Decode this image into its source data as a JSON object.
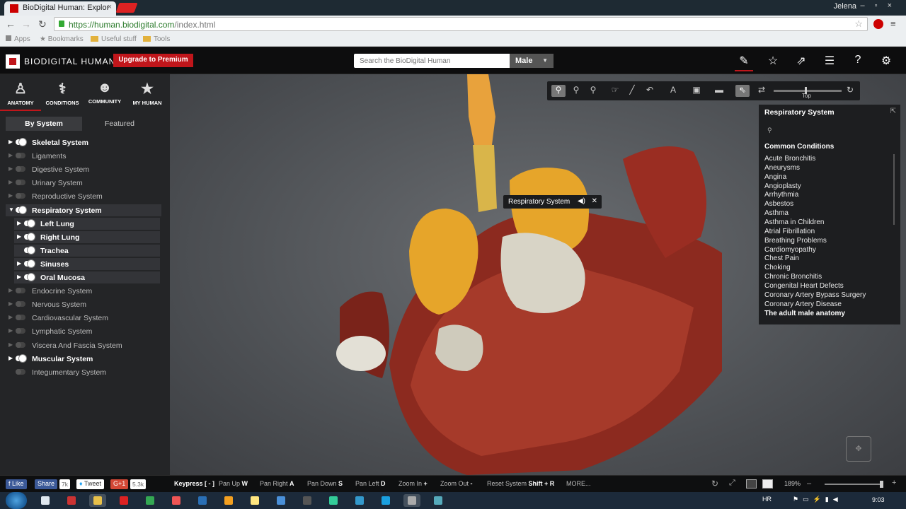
{
  "browser": {
    "tab_title": "BioDigital Human: Explor",
    "user_name": "Jelena",
    "url_secure": "https://human.biodigital.com",
    "url_path": "/index.html",
    "bookmarks": [
      "Apps",
      "Bookmarks",
      "Useful stuff",
      "Tools"
    ]
  },
  "header": {
    "brand": "BIODIGITAL HUMAN",
    "upgrade_label": "Upgrade to Premium",
    "search_placeholder": "Search the BioDigital Human",
    "gender": "Male",
    "icons": [
      "pencil-icon",
      "star-icon",
      "share-icon",
      "checklist-icon",
      "help-icon",
      "gear-icon"
    ]
  },
  "nav_tabs": [
    {
      "label": "ANATOMY",
      "icon": "body-icon"
    },
    {
      "label": "CONDITIONS",
      "icon": "stethoscope-icon"
    },
    {
      "label": "COMMUNITY",
      "icon": "people-icon"
    },
    {
      "label": "MY HUMAN",
      "icon": "star-icon"
    }
  ],
  "sub_tabs": {
    "by_system": "By System",
    "featured": "Featured"
  },
  "systems": [
    {
      "label": "Skeletal System",
      "on": true,
      "expandable": true
    },
    {
      "label": "Ligaments",
      "on": false,
      "expandable": true
    },
    {
      "label": "Digestive System",
      "on": false,
      "expandable": true
    },
    {
      "label": "Urinary System",
      "on": false,
      "expandable": true
    },
    {
      "label": "Reproductive System",
      "on": false,
      "expandable": true
    },
    {
      "label": "Respiratory System",
      "on": true,
      "expandable": true,
      "expanded": true
    },
    {
      "label": "Left Lung",
      "on": true,
      "expandable": true,
      "child": true
    },
    {
      "label": "Right Lung",
      "on": true,
      "expandable": true,
      "child": true
    },
    {
      "label": "Trachea",
      "on": true,
      "expandable": false,
      "child": true
    },
    {
      "label": "Sinuses",
      "on": true,
      "expandable": true,
      "child": true
    },
    {
      "label": "Oral Mucosa",
      "on": true,
      "expandable": true,
      "child": true
    },
    {
      "label": "Endocrine System",
      "on": false,
      "expandable": true
    },
    {
      "label": "Nervous System",
      "on": false,
      "expandable": true
    },
    {
      "label": "Cardiovascular System",
      "on": false,
      "expandable": true
    },
    {
      "label": "Lymphatic System",
      "on": false,
      "expandable": true
    },
    {
      "label": "Viscera And Fascia System",
      "on": false,
      "expandable": true
    },
    {
      "label": "Muscular System",
      "on": true,
      "expandable": true
    },
    {
      "label": "Integumentary System",
      "on": false,
      "expandable": false
    }
  ],
  "view_toolbar": {
    "slider_label": "Top",
    "tools": [
      "lungs-icon",
      "lungs-outline-icon",
      "lungs-outline-icon",
      "hand-pointer-icon",
      "pen-icon",
      "undo-icon",
      "text-icon",
      "camera-icon",
      "screen-icon",
      "select-arrow-icon",
      "rotate-icon",
      "refresh-icon"
    ]
  },
  "tooltip": {
    "label": "Respiratory System"
  },
  "info_panel": {
    "title": "Respiratory System",
    "section": "Common Conditions",
    "conditions": [
      "Acute Bronchitis",
      "Aneurysms",
      "Angina",
      "Angioplasty",
      "Arrhythmia",
      "Asbestos",
      "Asthma",
      "Asthma in Children",
      "Atrial Fibrillation",
      "Breathing Problems",
      "Cardiomyopathy",
      "Chest Pain",
      "Choking",
      "Chronic Bronchitis",
      "Congenital Heart Defects",
      "Coronary Artery Bypass Surgery",
      "Coronary Artery Disease"
    ],
    "footer": "The adult male anatomy"
  },
  "footer": {
    "like": "Like",
    "share": "Share",
    "share_count": "7k",
    "tweet": "Tweet",
    "gplus": "G+1",
    "gplus_count": "5.3k",
    "keypress_label": "Keypress [ - ]",
    "keys": [
      {
        "label": "Pan Up",
        "key": "W"
      },
      {
        "label": "Pan Right",
        "key": "A"
      },
      {
        "label": "Pan Down",
        "key": "S"
      },
      {
        "label": "Pan Left",
        "key": "D"
      },
      {
        "label": "Zoom In",
        "key": "+"
      },
      {
        "label": "Zoom Out",
        "key": "-"
      },
      {
        "label": "Reset System",
        "key": "Shift + R"
      }
    ],
    "more": "MORE...",
    "zoom": "189%"
  },
  "taskbar": {
    "lang": "HR",
    "time": "9:03"
  }
}
